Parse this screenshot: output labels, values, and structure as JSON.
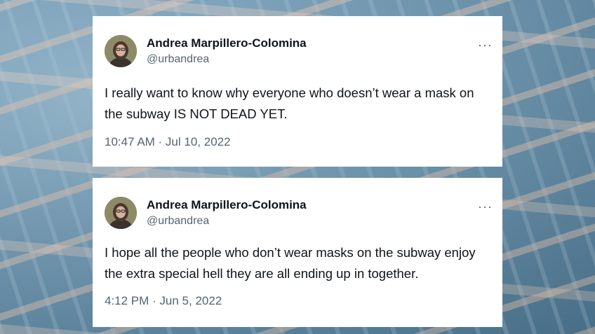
{
  "tweets": [
    {
      "author_name": "Andrea Marpillero-Colomina",
      "handle": "@urbandrea",
      "text": "I really want to know why everyone who doesn’t wear a mask on the subway IS NOT DEAD YET.",
      "timestamp": "10:47 AM · Jul 10, 2022",
      "more_icon": "···"
    },
    {
      "author_name": "Andrea Marpillero-Colomina",
      "handle": "@urbandrea",
      "text": "I hope all the people who don’t wear masks on the subway enjoy the extra special hell they are all ending up in together.",
      "timestamp": "4:12 PM · Jun 5, 2022",
      "more_icon": "···"
    }
  ],
  "colors": {
    "background": "#6f98b3",
    "card": "#ffffff",
    "primary_text": "#0f1419",
    "secondary_text": "#536471"
  },
  "icons": {
    "avatar": "avatar-photo",
    "more": "more-options-icon"
  }
}
